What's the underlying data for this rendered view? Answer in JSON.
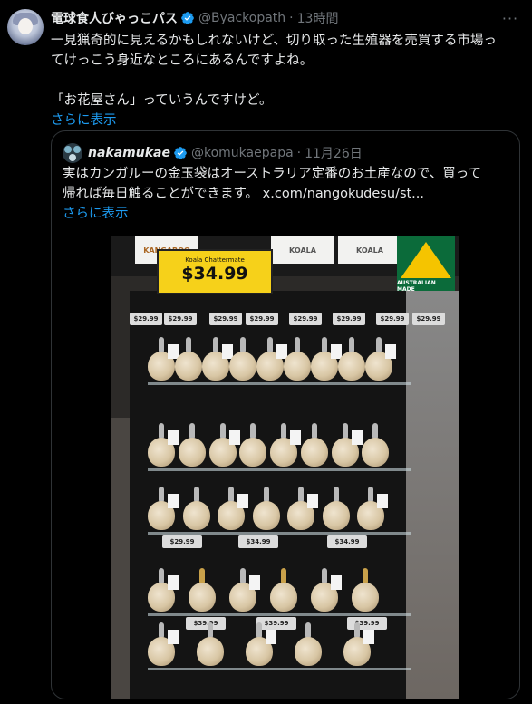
{
  "tweet": {
    "name": "電球食人びゃっこパス",
    "handle": "@Byackopath",
    "separator": "·",
    "time": "13時間",
    "more_icon": "more-dots-icon",
    "text_lines": [
      "一見猟奇的に見えるかもしれないけど、切り取った生殖器を売買する市場っ",
      "てけっこう身近なところにあるんですよね。",
      "",
      "「お花屋さん」っていうんですけど。"
    ],
    "show_more": "さらに表示"
  },
  "quote": {
    "name": "nakamukae",
    "handle": "@komukaepapa",
    "separator": "·",
    "date": "11月26日",
    "text_lines": [
      "実はカンガルーの金玉袋はオーストラリア定番のお土産なので、買って",
      "帰れば毎日触ることができます。 x.com/nangokudesu/st..."
    ],
    "show_more": "さらに表示"
  },
  "photo": {
    "sign_line1": "Koala Chattermate",
    "sign_price": "$34.99",
    "cards": [
      "KANGAROO",
      "KOALA",
      "KOALA"
    ],
    "logo_text": "AUSTRALIAN MADE",
    "prices": [
      "$29.99",
      "$29.99",
      "$29.99",
      "$29.99",
      "$29.99",
      "$29.99",
      "$29.99",
      "$29.99",
      "$29.99",
      "$34.99",
      "$34.99",
      "$34.99",
      "$39.99",
      "$39.99",
      "$39.99"
    ]
  },
  "colors": {
    "background": "#000000",
    "text": "#e7e9ea",
    "muted": "#71767b",
    "link": "#1d9bf0",
    "verified": "#1d9bf0",
    "border": "#2f3336"
  }
}
